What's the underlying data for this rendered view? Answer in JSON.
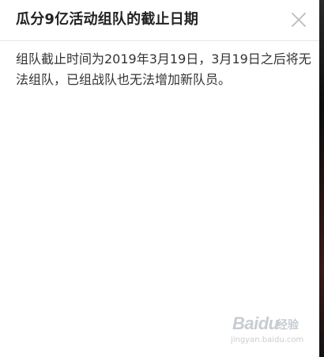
{
  "dialog": {
    "title": "瓜分9亿活动组队的截止日期",
    "close_icon": "close-icon",
    "body_text": "组队截止时间为2019年3月19日，3月19日之后将无法组队，已组战队也无法增加新队员。"
  },
  "watermark": {
    "logo": "Baidu",
    "subtitle": "经验",
    "url": "jingyan.baidu.com"
  },
  "colors": {
    "title": "#222222",
    "body": "#333333",
    "close_icon": "#bbbbbb",
    "divider": "#e6e6e6"
  }
}
